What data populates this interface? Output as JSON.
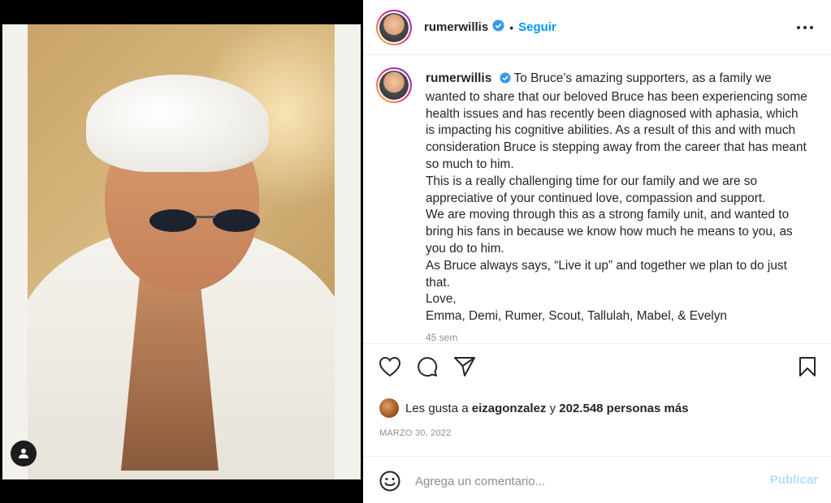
{
  "post": {
    "username": "rumerwillis",
    "follow_label": "Seguir",
    "separator": "•",
    "caption_lines": [
      "To Bruce’s amazing supporters, as a family we wanted to share that our beloved Bruce has been experiencing some health issues and has recently been diagnosed with aphasia, which is impacting his cognitive abilities. As a result of this and with much consideration Bruce is stepping away from the career that has meant so much to him.",
      "This is a really challenging time for our family and we are so appreciative of your continued love, compassion and support.",
      "We are moving through this as a strong family unit, and wanted to bring his fans in because we know how much he means to you, as you do to him.",
      "As Bruce always says, “Live it up” and together we plan to do just that.",
      "Love,",
      "Emma, Demi, Rumer, Scout, Tallulah, Mabel, & Evelyn"
    ],
    "time_ago": "45 sem",
    "likes": {
      "prefix": "Les gusta a",
      "liker": "eizagonzalez",
      "connector": "y",
      "others": "202.548 personas más"
    },
    "date": "MARZO 30, 2022"
  },
  "comment": {
    "placeholder": "Agrega un comentario...",
    "post_label": "Publicar"
  },
  "icons": {
    "like": "heart-icon",
    "comment": "comment-bubble-icon",
    "share": "paper-plane-icon",
    "save": "bookmark-icon",
    "more": "more-options-icon",
    "emoji": "emoji-icon",
    "verified": "verified-badge-icon",
    "tag": "user-tag-icon"
  },
  "colors": {
    "accent": "#0095f6",
    "verified": "#3897f0",
    "muted": "#8e8e8e",
    "publish_disabled": "#b2dffc"
  }
}
